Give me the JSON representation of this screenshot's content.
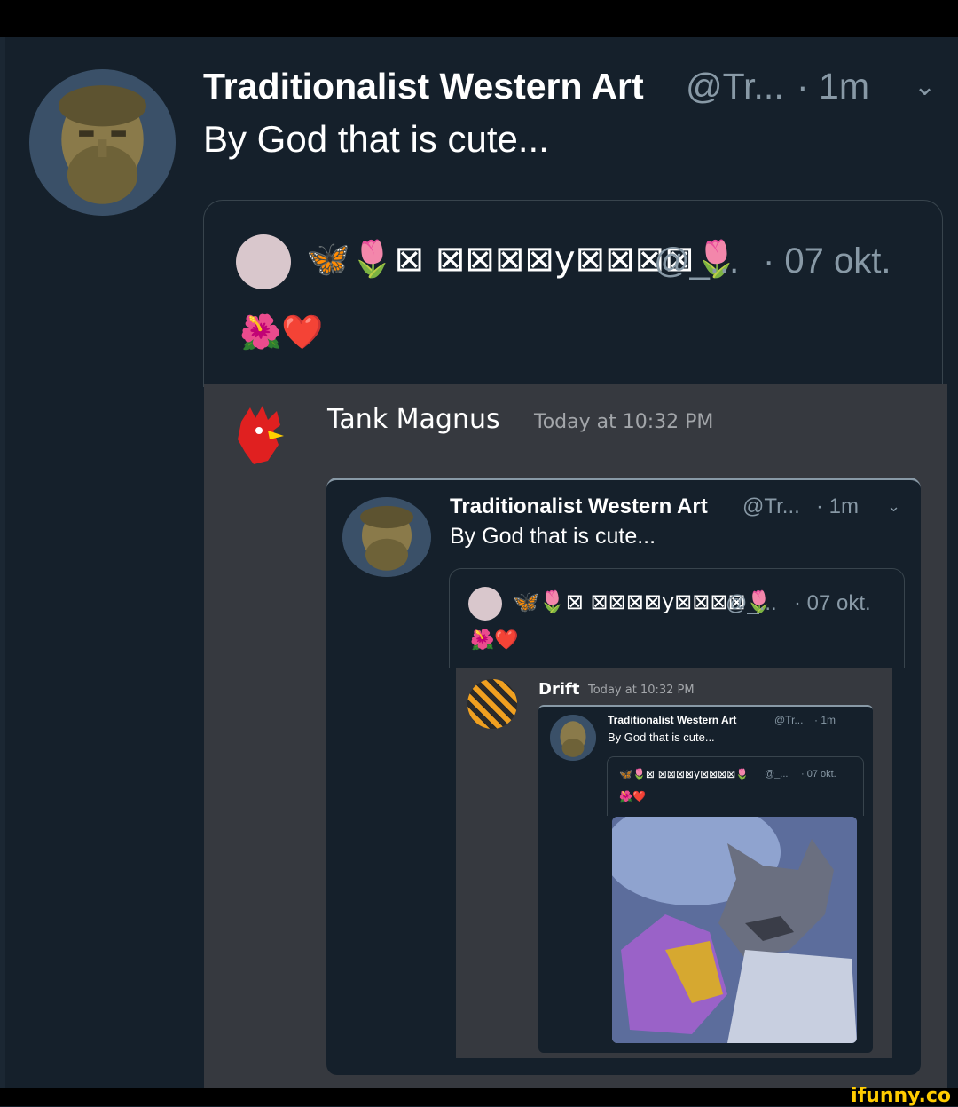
{
  "tweet": {
    "author": "Traditionalist Western Art",
    "handle": "@Tr...",
    "time": "· 1m",
    "text": "By God that is cute..."
  },
  "quoted": {
    "name": "🦋🌷⊠ ⊠⊠⊠⊠y⊠⊠⊠⊠🌷",
    "handle": "@_...",
    "date": "· 07 okt.",
    "emoji": "🌺❤️"
  },
  "discord1": {
    "user": "Tank Magnus",
    "time": "Today at 10:32 PM"
  },
  "discord2": {
    "user": "Drift",
    "time": "Today at 10:32 PM"
  },
  "watermark": "ifunny.co",
  "colors": {
    "bg": "#15202b",
    "discord": "#36393f",
    "muted": "#8899a6"
  }
}
